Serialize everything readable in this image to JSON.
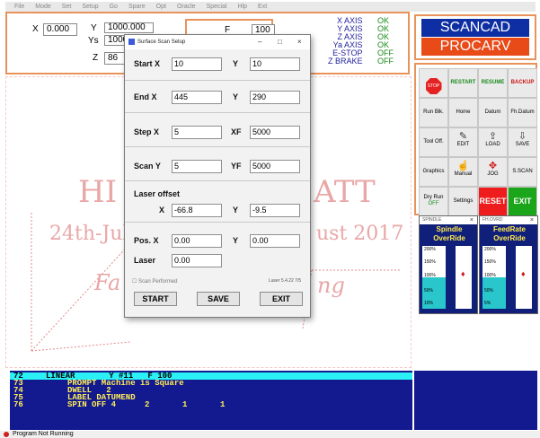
{
  "menu": [
    "File",
    "Mode",
    "Set",
    "Setup",
    "Go",
    "Spare",
    "Opt",
    "Oracle",
    "Special",
    "Hlp",
    "Ext"
  ],
  "coords": {
    "x_label": "X",
    "x_value": "0.000",
    "y_label": "Y",
    "y_value": "1000.000",
    "ys_label": "Ys",
    "ys_value": "1000",
    "z_label": "Z",
    "z_value": "86",
    "f_label": "F",
    "f_value": "100"
  },
  "axis_status": [
    {
      "name": "X AXIS",
      "state": "OK"
    },
    {
      "name": "Y AXIS",
      "state": "OK"
    },
    {
      "name": "Z AXIS",
      "state": "OK"
    },
    {
      "name": "Ya AXIS",
      "state": "OK"
    },
    {
      "name": "E-STOP",
      "state": "OFF"
    },
    {
      "name": "Z BRAKE",
      "state": "OFF"
    }
  ],
  "logo": {
    "top": "SCANCAD",
    "bottom": "PROCARV"
  },
  "canvas_text": {
    "line1": "HI",
    "line1b": "ATT",
    "line2": "24th-Jul",
    "line2b": "ust 2017",
    "line3": "Fa",
    "line3b": "ng"
  },
  "tools": {
    "stop": "STOP",
    "restart": "RESTART",
    "resume": "RESUME",
    "backup": "BACKUP",
    "run_blk": "Run Blk.",
    "home": "Home",
    "datum": "Datum",
    "fh_datum": "Fh.Datum",
    "tool_off": "Tool Off.",
    "edit": "EDIT",
    "load": "LOAD",
    "save": "SAVE",
    "graphics": "Graphics",
    "manual": "Manual",
    "jog": "JOG",
    "sscan": "S.SCAN",
    "dry_run": "Dry Run",
    "dry_run_state": "OFF",
    "settings": "Settings",
    "reset": "RESET",
    "exit": "EXIT"
  },
  "spindle": {
    "caption": "SPINDLE",
    "title": "Spindle OverRide",
    "ticks": [
      "200%",
      "150%",
      "100%",
      "50%",
      "10%"
    ],
    "level_percent": 100
  },
  "feedrate": {
    "caption": "FH.OVRD",
    "title": "FeedRate OverRide",
    "ticks": [
      "200%",
      "150%",
      "100%",
      "50%",
      "5%"
    ],
    "level_percent": 100
  },
  "gcode": [
    {
      "n": "72",
      "text": "LINEAR       Y #11   F 100",
      "c1": "",
      "c2": "",
      "c3": "",
      "highlight": true
    },
    {
      "n": "73",
      "text": "PROMPT Machine is Square",
      "c1": "",
      "c2": "",
      "c3": "",
      "highlight": false
    },
    {
      "n": "74",
      "text": "DWELL   2",
      "c1": "",
      "c2": "",
      "c3": "",
      "highlight": false
    },
    {
      "n": "75",
      "text": "LABEL DATUMEND",
      "c1": "",
      "c2": "",
      "c3": "",
      "highlight": false
    },
    {
      "n": "76",
      "text": "SPIN OFF 4",
      "c1": "2",
      "c2": "1",
      "c3": "1",
      "highlight": false
    }
  ],
  "status_text": "Program Not Running",
  "dialog": {
    "title": "Surface Scan Setup",
    "start_label": "Start  X",
    "start_x": "10",
    "start_y_label": "Y",
    "start_y": "10",
    "end_label": "End  X",
    "end_x": "445",
    "end_y_label": "Y",
    "end_y": "290",
    "step_label": "Step  X",
    "step_x": "5",
    "xf_label": "XF",
    "xf": "5000",
    "scan_label": "Scan  Y",
    "scan_y": "5",
    "yf_label": "YF",
    "yf": "5000",
    "offset_label": "Laser offset",
    "offset_x_label": "X",
    "offset_x": "-66.8",
    "offset_y_label": "Y",
    "offset_y": "-9.5",
    "pos_label": "Pos.  X",
    "pos_x": "0.00",
    "pos_y_label": "Y",
    "pos_y": "0.00",
    "laser_label": "Laser",
    "laser": "0.00",
    "scan_performed": "Scan Performed",
    "version": "Laser 5.4.22 7/5",
    "start_btn": "START",
    "save_btn": "SAVE",
    "exit_btn": "EXIT"
  }
}
